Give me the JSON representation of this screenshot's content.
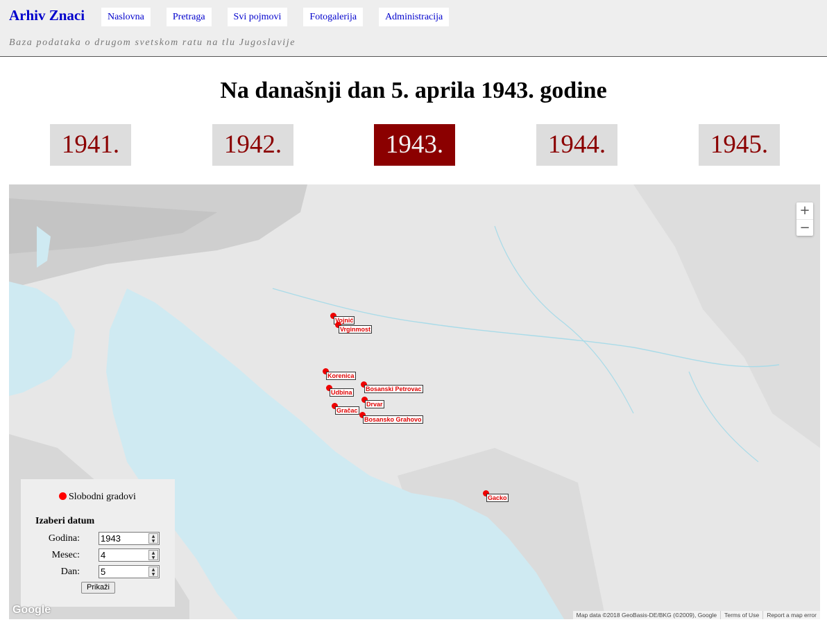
{
  "header": {
    "brand": "Arhiv Znaci",
    "tagline": "Baza podataka o drugom svetskom ratu na tlu Jugoslavije",
    "nav": [
      "Naslovna",
      "Pretraga",
      "Svi pojmovi",
      "Fotogalerija",
      "Administracija"
    ]
  },
  "title": "Na današnji dan 5. aprila 1943. godine",
  "years": [
    "1941.",
    "1942.",
    "1943.",
    "1944.",
    "1945."
  ],
  "active_year": "1943.",
  "colors": {
    "accent": "#8b0000",
    "marker": "#ee0000",
    "link": "#0000cc",
    "sea": "#cfeaf2"
  },
  "map": {
    "zoom_in": "+",
    "zoom_out": "−",
    "cities": [
      "Vojnić",
      "Vrginmost",
      "Korenica",
      "Udbina",
      "Bosanski Petrovac",
      "Drvar",
      "Gračac",
      "Bosansko Grahovo",
      "Gacko"
    ],
    "google_logo": "Google",
    "attribution": {
      "data": "Map data ©2018 GeoBasis-DE/BKG (©2009), Google",
      "terms": "Terms of Use",
      "report": "Report a map error"
    }
  },
  "panel": {
    "legend": "Slobodni gradovi",
    "title": "Izaberi datum",
    "year_label": "Godina:",
    "year_value": "1943",
    "month_label": "Mesec:",
    "month_value": "4",
    "day_label": "Dan:",
    "day_value": "5",
    "button": "Prikaži"
  }
}
